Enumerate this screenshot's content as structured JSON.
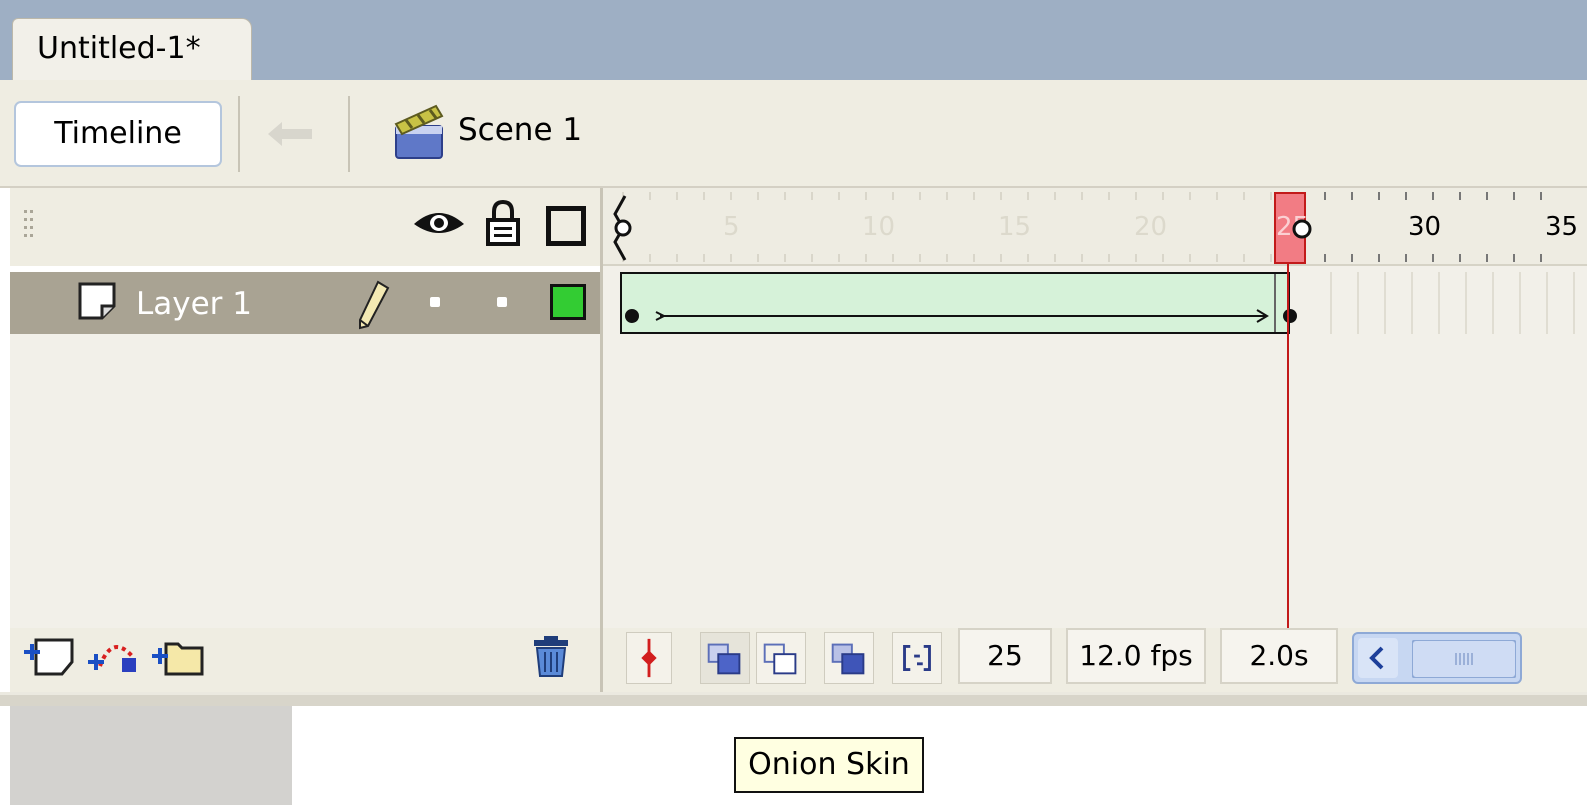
{
  "document": {
    "tab_title": "Untitled-1*"
  },
  "edit_bar": {
    "timeline_label": "Timeline",
    "scene_label": "Scene 1",
    "icons": [
      "back-arrow-icon",
      "scene-clapper-icon"
    ]
  },
  "layer_header": {
    "icons": [
      "eye-icon",
      "lock-icon",
      "outline-icon"
    ]
  },
  "layers": [
    {
      "name": "Layer 1",
      "selected": true,
      "visible": true,
      "locked": false,
      "outline_color": "#33cc33"
    }
  ],
  "ruler": {
    "labels": [
      "5",
      "10",
      "15",
      "20",
      "25",
      "30",
      "35"
    ]
  },
  "timeline_status": {
    "current_frame": "25",
    "frame_rate": "12.0 fps",
    "elapsed_time": "2.0s"
  },
  "bottom_tools": [
    "insert-layer-icon",
    "add-motion-guide-icon",
    "insert-folder-icon",
    "trash-icon"
  ],
  "timeline_tools": [
    "center-frame-icon",
    "onion-skin-icon",
    "onion-skin-outlines-icon",
    "edit-multiple-frames-icon",
    "modify-markers-icon"
  ],
  "tooltip": "Onion Skin",
  "colors": {
    "tab_strip": "#9eafc4",
    "selected_layer": "#a9a393",
    "tween_fill": "#d6f2d9",
    "playhead": "#c21a1a"
  }
}
